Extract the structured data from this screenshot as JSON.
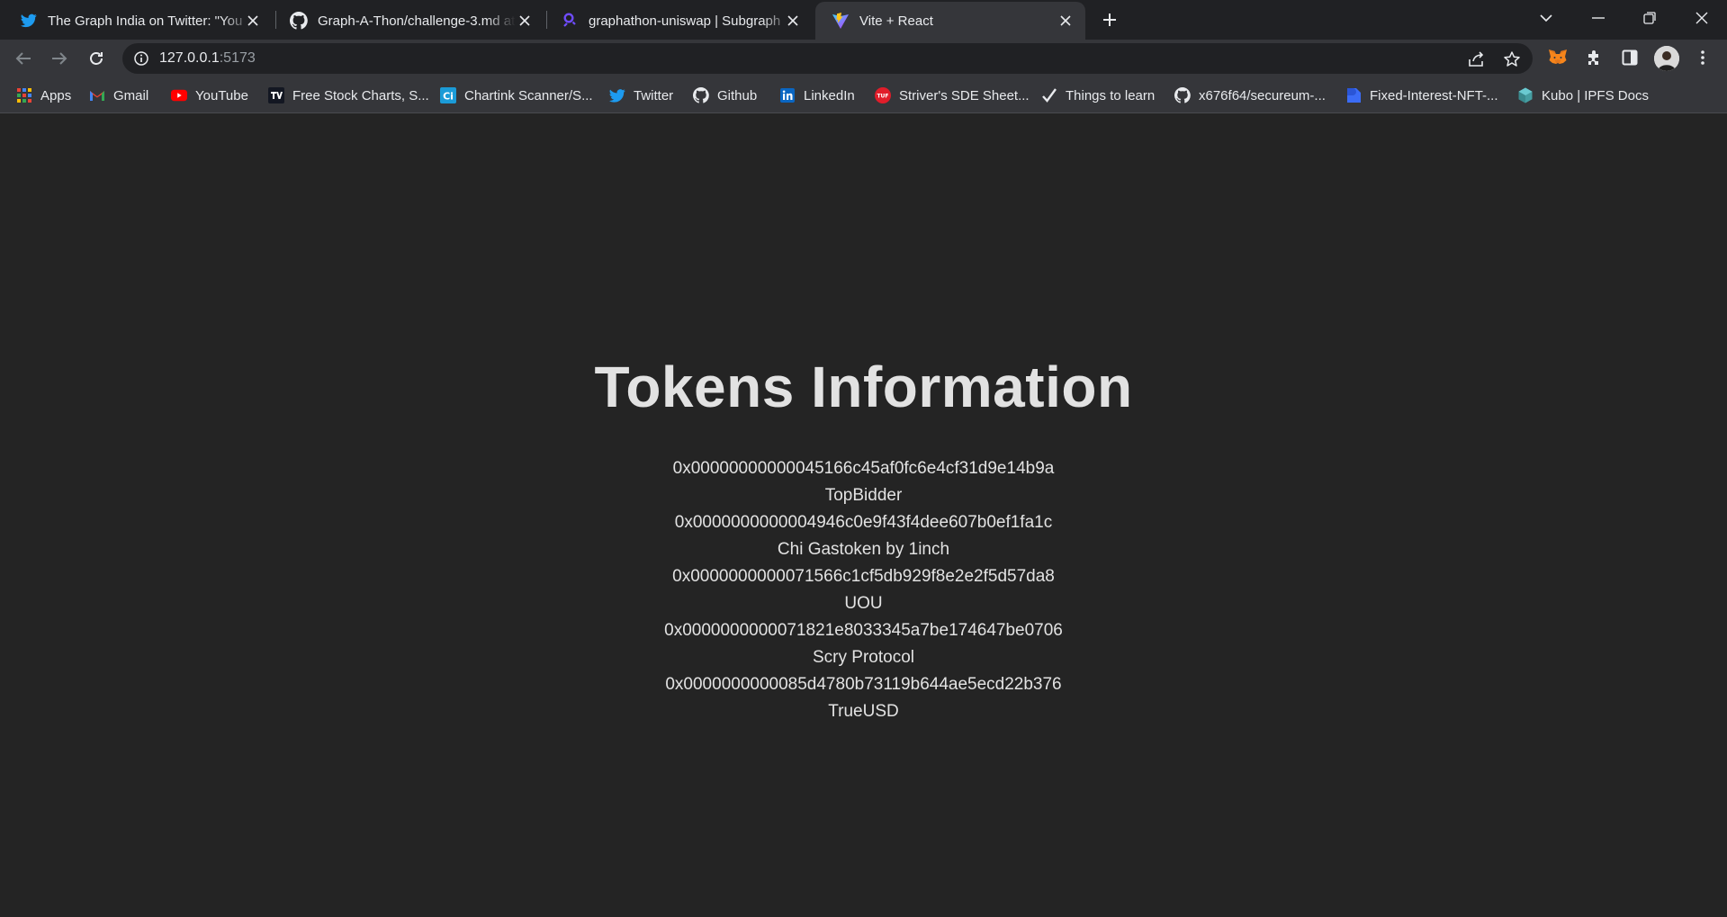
{
  "browser": {
    "tabs": [
      {
        "title": "The Graph India on Twitter: \"You",
        "favicon": "twitter-icon",
        "active": false
      },
      {
        "title": "Graph-A-Thon/challenge-3.md at",
        "favicon": "github-icon",
        "active": false
      },
      {
        "title": "graphathon-uniswap | Subgraph",
        "favicon": "thegraph-icon",
        "active": false
      },
      {
        "title": "Vite + React",
        "favicon": "vite-icon",
        "active": true
      }
    ],
    "address": {
      "host": "127.0.0.1",
      "port": ":5173"
    },
    "bookmarks": [
      {
        "label": "Apps",
        "icon": "apps-grid-icon"
      },
      {
        "label": "Gmail",
        "icon": "gmail-icon"
      },
      {
        "label": "YouTube",
        "icon": "youtube-icon"
      },
      {
        "label": "Free Stock Charts, S...",
        "icon": "tradingview-icon"
      },
      {
        "label": "Chartink Scanner/S...",
        "icon": "chartink-icon"
      },
      {
        "label": "Twitter",
        "icon": "twitter-icon"
      },
      {
        "label": "Github",
        "icon": "github-icon"
      },
      {
        "label": "LinkedIn",
        "icon": "linkedin-icon"
      },
      {
        "label": "Striver's SDE Sheet...",
        "icon": "tuf-icon"
      },
      {
        "label": "Things to learn",
        "icon": "checkmark-icon"
      },
      {
        "label": "x676f64/secureum-...",
        "icon": "github-icon"
      },
      {
        "label": "Fixed-Interest-NFT-...",
        "icon": "bookmark-blue-icon"
      },
      {
        "label": "Kubo | IPFS Docs",
        "icon": "ipfs-icon"
      }
    ],
    "colors": {
      "tabstrip": "#202124",
      "toolbar": "#35363a",
      "page_background": "#242424"
    }
  },
  "page": {
    "title": "Tokens Information",
    "tokens": [
      {
        "id": "0x00000000000045166c45af0fc6e4cf31d9e14b9a",
        "name": "TopBidder"
      },
      {
        "id": "0x0000000000004946c0e9f43f4dee607b0ef1fa1c",
        "name": "Chi Gastoken by 1inch"
      },
      {
        "id": "0x0000000000071566c1cf5db929f8e2e2f5d57da8",
        "name": "UOU"
      },
      {
        "id": "0x0000000000071821e8033345a7be174647be0706",
        "name": "Scry Protocol"
      },
      {
        "id": "0x0000000000085d4780b73119b644ae5ecd22b376",
        "name": "TrueUSD"
      }
    ]
  }
}
